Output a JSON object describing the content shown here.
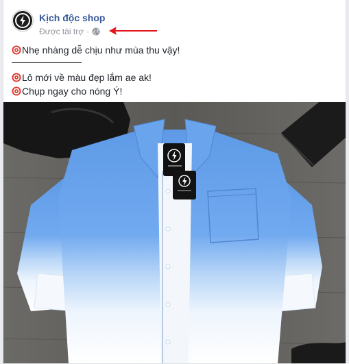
{
  "post": {
    "page_name": "Kịch độc shop",
    "sponsored_label": "Được tài trợ",
    "separator": "·",
    "audience_icon": "globe-icon",
    "lines": [
      "Nhẹ nhàng dễ chịu như mùa thu vậy!",
      "Lô mới về màu đẹp lắm ae ak!",
      "Chụp ngay cho nóng Ý!"
    ],
    "bullet_icon": "target-emoji-icon",
    "annotation_icon": "red-arrow-icon"
  },
  "colors": {
    "link": "#365899",
    "meta": "#90949c",
    "arrow": "#e4141b",
    "bullet": "#e0342d"
  }
}
